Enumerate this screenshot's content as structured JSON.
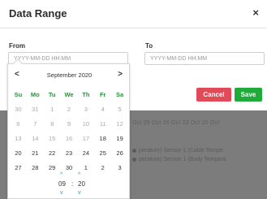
{
  "modal": {
    "title": "Data Range",
    "close_icon": "×"
  },
  "from": {
    "label": "From",
    "placeholder": "YYYY-MM-DD HH:MM"
  },
  "to": {
    "label": "To",
    "placeholder": "YYYY-MM-DD HH:MM"
  },
  "buttons": {
    "cancel": "Cancel",
    "save": "Save"
  },
  "colors": {
    "cancel": "#e04b57",
    "save": "#1faa3a",
    "weekday": "#27923a"
  },
  "datepicker": {
    "prev_icon": "<",
    "next_icon": ">",
    "month_label": "September 2020",
    "weekdays": [
      "Su",
      "Mo",
      "Tu",
      "We",
      "Th",
      "Fr",
      "Sa"
    ],
    "weeks": [
      [
        {
          "d": "30",
          "m": true
        },
        {
          "d": "31",
          "m": true
        },
        {
          "d": "1",
          "m": true
        },
        {
          "d": "2",
          "m": true
        },
        {
          "d": "3",
          "m": true
        },
        {
          "d": "4",
          "m": true
        },
        {
          "d": "5",
          "m": true
        }
      ],
      [
        {
          "d": "6",
          "m": true
        },
        {
          "d": "7",
          "m": true
        },
        {
          "d": "8",
          "m": true
        },
        {
          "d": "9",
          "m": true
        },
        {
          "d": "10",
          "m": true
        },
        {
          "d": "11",
          "m": true
        },
        {
          "d": "12",
          "m": true
        }
      ],
      [
        {
          "d": "13",
          "m": true
        },
        {
          "d": "14",
          "m": true
        },
        {
          "d": "15",
          "m": true
        },
        {
          "d": "16",
          "m": true
        },
        {
          "d": "17",
          "m": true
        },
        {
          "d": "18",
          "m": false
        },
        {
          "d": "19",
          "m": false
        }
      ],
      [
        {
          "d": "20",
          "m": false
        },
        {
          "d": "21",
          "m": false
        },
        {
          "d": "22",
          "m": false
        },
        {
          "d": "23",
          "m": false
        },
        {
          "d": "24",
          "m": false
        },
        {
          "d": "25",
          "m": false
        },
        {
          "d": "26",
          "m": false
        }
      ],
      [
        {
          "d": "27",
          "m": false
        },
        {
          "d": "28",
          "m": false
        },
        {
          "d": "29",
          "m": false
        },
        {
          "d": "30",
          "m": false
        },
        {
          "d": "1",
          "m": false
        },
        {
          "d": "2",
          "m": false
        },
        {
          "d": "3",
          "m": false
        }
      ]
    ],
    "time": {
      "hour": "09",
      "separator": ":",
      "minute": "20",
      "up_icon": "^",
      "down_icon": "v"
    }
  },
  "background": {
    "ticks": "Oct   29 Oct   26 Oct   23 Oct   20 Oct",
    "legend": [
      "perature)     Sensor 1 (Cable Tempe",
      "perature)     Sensor 1 (Body Tempera"
    ]
  }
}
